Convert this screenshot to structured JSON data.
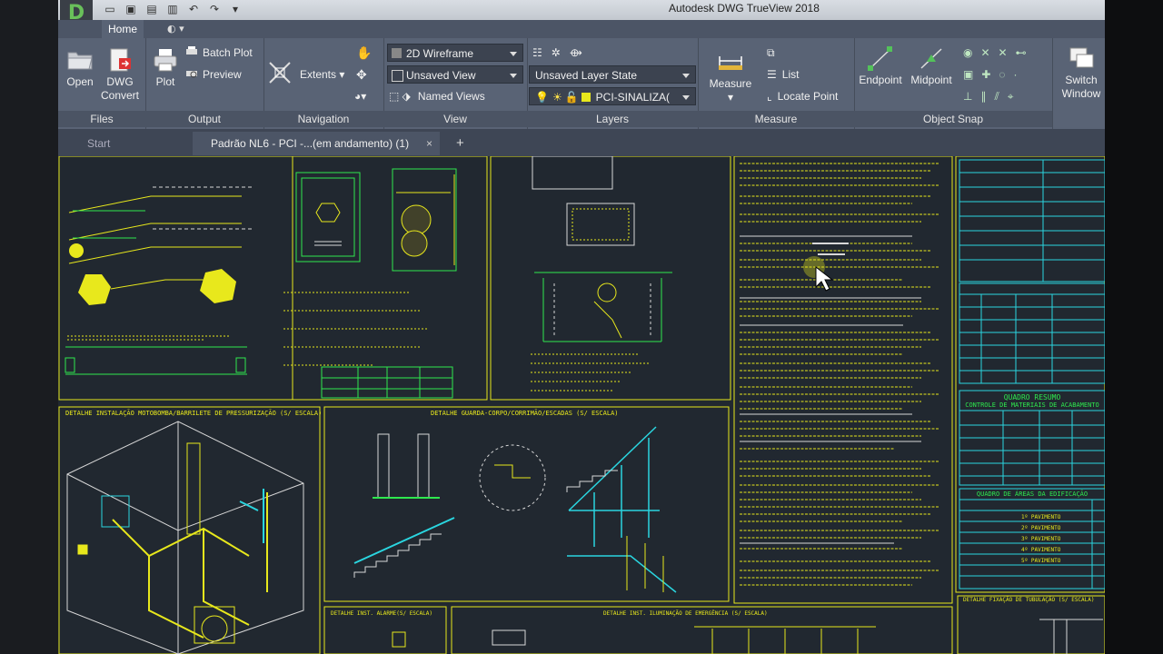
{
  "app": {
    "title": "Autodesk DWG TrueView 2018",
    "logo_letter": "D"
  },
  "ribbon": {
    "home_tab": "Home",
    "panels": {
      "files": {
        "title": "Files",
        "open": "Open",
        "dwg_convert_line1": "DWG",
        "dwg_convert_line2": "Convert"
      },
      "output": {
        "title": "Output",
        "plot": "Plot",
        "batch_plot": "Batch Plot",
        "preview": "Preview"
      },
      "navigation": {
        "title": "Navigation",
        "extents": "Extents"
      },
      "view": {
        "title": "View",
        "visual_style": "2D Wireframe",
        "saved_view": "Unsaved View",
        "named_views": "Named Views"
      },
      "layers": {
        "title": "Layers",
        "layer_state": "Unsaved Layer State",
        "current_layer": "PCI-SINALIZA("
      },
      "measure": {
        "title": "Measure",
        "measure": "Measure",
        "list": "List",
        "locate_point": "Locate Point"
      },
      "object_snap": {
        "title": "Object Snap",
        "endpoint": "Endpoint",
        "midpoint": "Midpoint"
      },
      "window": {
        "switch_line1": "Switch",
        "switch_line2": "Window"
      }
    }
  },
  "document_tabs": {
    "start": "Start",
    "active": "Padrão NL6 - PCI -...(em andamento) (1)",
    "close": "×",
    "new_tab": "+"
  },
  "colors": {
    "canvas": "#212830",
    "ribbon": "#596375",
    "yellow_lines": "#e8e81c",
    "green_lines": "#2ee84e",
    "cyan_lines": "#2ad6e0",
    "white_lines": "#d8d8d8"
  },
  "drawing": {
    "title_pressurization": "DETALHE INSTALAÇÃO MOTOBOMBA/BARRILETE DE PRESSURIZAÇÃO (S/ ESCALA)",
    "title_guardrail": "DETALHE GUARDA-CORPO/CORRIMÃO/ESCADAS (S/ ESCALA)",
    "title_alarm": "DETALHE INST. ALARME(S/ ESCALA)",
    "title_lighting": "DETALHE INST. ILUMINAÇÃO DE EMERGÊNCIA (S/ ESCALA)",
    "title_pipe": "DETALHE FIXAÇÃO DE TUBULAÇÃO (S/ ESCALA)",
    "summary_title": "QUADRO RESUMO",
    "summary_subtitle": "CONTROLE DE MATERIAIS DE ACABAMENTO",
    "areas_title": "QUADRO DE ÁREAS DA EDIFICAÇÃO",
    "floors": [
      "1º PAVIMENTO",
      "2º PAVIMENTO",
      "3º PAVIMENTO",
      "4º PAVIMENTO",
      "5º PAVIMENTO"
    ]
  }
}
